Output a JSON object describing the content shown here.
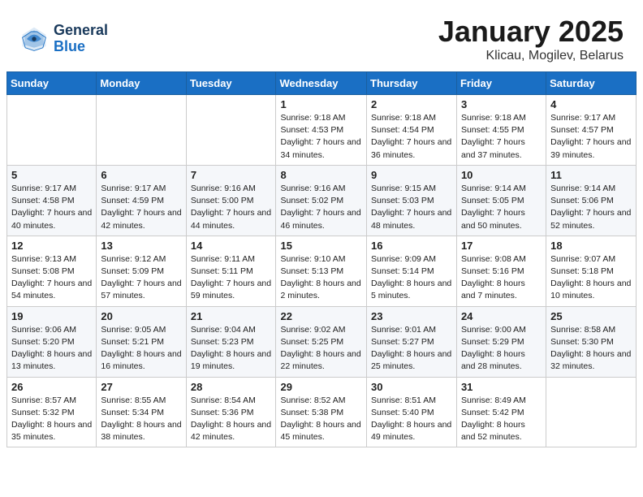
{
  "header": {
    "logo_line1": "General",
    "logo_line2": "Blue",
    "month_title": "January 2025",
    "location": "Klicau, Mogilev, Belarus"
  },
  "weekdays": [
    "Sunday",
    "Monday",
    "Tuesday",
    "Wednesday",
    "Thursday",
    "Friday",
    "Saturday"
  ],
  "weeks": [
    [
      {
        "day": "",
        "sunrise": "",
        "sunset": "",
        "daylight": ""
      },
      {
        "day": "",
        "sunrise": "",
        "sunset": "",
        "daylight": ""
      },
      {
        "day": "",
        "sunrise": "",
        "sunset": "",
        "daylight": ""
      },
      {
        "day": "1",
        "sunrise": "Sunrise: 9:18 AM",
        "sunset": "Sunset: 4:53 PM",
        "daylight": "Daylight: 7 hours and 34 minutes."
      },
      {
        "day": "2",
        "sunrise": "Sunrise: 9:18 AM",
        "sunset": "Sunset: 4:54 PM",
        "daylight": "Daylight: 7 hours and 36 minutes."
      },
      {
        "day": "3",
        "sunrise": "Sunrise: 9:18 AM",
        "sunset": "Sunset: 4:55 PM",
        "daylight": "Daylight: 7 hours and 37 minutes."
      },
      {
        "day": "4",
        "sunrise": "Sunrise: 9:17 AM",
        "sunset": "Sunset: 4:57 PM",
        "daylight": "Daylight: 7 hours and 39 minutes."
      }
    ],
    [
      {
        "day": "5",
        "sunrise": "Sunrise: 9:17 AM",
        "sunset": "Sunset: 4:58 PM",
        "daylight": "Daylight: 7 hours and 40 minutes."
      },
      {
        "day": "6",
        "sunrise": "Sunrise: 9:17 AM",
        "sunset": "Sunset: 4:59 PM",
        "daylight": "Daylight: 7 hours and 42 minutes."
      },
      {
        "day": "7",
        "sunrise": "Sunrise: 9:16 AM",
        "sunset": "Sunset: 5:00 PM",
        "daylight": "Daylight: 7 hours and 44 minutes."
      },
      {
        "day": "8",
        "sunrise": "Sunrise: 9:16 AM",
        "sunset": "Sunset: 5:02 PM",
        "daylight": "Daylight: 7 hours and 46 minutes."
      },
      {
        "day": "9",
        "sunrise": "Sunrise: 9:15 AM",
        "sunset": "Sunset: 5:03 PM",
        "daylight": "Daylight: 7 hours and 48 minutes."
      },
      {
        "day": "10",
        "sunrise": "Sunrise: 9:14 AM",
        "sunset": "Sunset: 5:05 PM",
        "daylight": "Daylight: 7 hours and 50 minutes."
      },
      {
        "day": "11",
        "sunrise": "Sunrise: 9:14 AM",
        "sunset": "Sunset: 5:06 PM",
        "daylight": "Daylight: 7 hours and 52 minutes."
      }
    ],
    [
      {
        "day": "12",
        "sunrise": "Sunrise: 9:13 AM",
        "sunset": "Sunset: 5:08 PM",
        "daylight": "Daylight: 7 hours and 54 minutes."
      },
      {
        "day": "13",
        "sunrise": "Sunrise: 9:12 AM",
        "sunset": "Sunset: 5:09 PM",
        "daylight": "Daylight: 7 hours and 57 minutes."
      },
      {
        "day": "14",
        "sunrise": "Sunrise: 9:11 AM",
        "sunset": "Sunset: 5:11 PM",
        "daylight": "Daylight: 7 hours and 59 minutes."
      },
      {
        "day": "15",
        "sunrise": "Sunrise: 9:10 AM",
        "sunset": "Sunset: 5:13 PM",
        "daylight": "Daylight: 8 hours and 2 minutes."
      },
      {
        "day": "16",
        "sunrise": "Sunrise: 9:09 AM",
        "sunset": "Sunset: 5:14 PM",
        "daylight": "Daylight: 8 hours and 5 minutes."
      },
      {
        "day": "17",
        "sunrise": "Sunrise: 9:08 AM",
        "sunset": "Sunset: 5:16 PM",
        "daylight": "Daylight: 8 hours and 7 minutes."
      },
      {
        "day": "18",
        "sunrise": "Sunrise: 9:07 AM",
        "sunset": "Sunset: 5:18 PM",
        "daylight": "Daylight: 8 hours and 10 minutes."
      }
    ],
    [
      {
        "day": "19",
        "sunrise": "Sunrise: 9:06 AM",
        "sunset": "Sunset: 5:20 PM",
        "daylight": "Daylight: 8 hours and 13 minutes."
      },
      {
        "day": "20",
        "sunrise": "Sunrise: 9:05 AM",
        "sunset": "Sunset: 5:21 PM",
        "daylight": "Daylight: 8 hours and 16 minutes."
      },
      {
        "day": "21",
        "sunrise": "Sunrise: 9:04 AM",
        "sunset": "Sunset: 5:23 PM",
        "daylight": "Daylight: 8 hours and 19 minutes."
      },
      {
        "day": "22",
        "sunrise": "Sunrise: 9:02 AM",
        "sunset": "Sunset: 5:25 PM",
        "daylight": "Daylight: 8 hours and 22 minutes."
      },
      {
        "day": "23",
        "sunrise": "Sunrise: 9:01 AM",
        "sunset": "Sunset: 5:27 PM",
        "daylight": "Daylight: 8 hours and 25 minutes."
      },
      {
        "day": "24",
        "sunrise": "Sunrise: 9:00 AM",
        "sunset": "Sunset: 5:29 PM",
        "daylight": "Daylight: 8 hours and 28 minutes."
      },
      {
        "day": "25",
        "sunrise": "Sunrise: 8:58 AM",
        "sunset": "Sunset: 5:30 PM",
        "daylight": "Daylight: 8 hours and 32 minutes."
      }
    ],
    [
      {
        "day": "26",
        "sunrise": "Sunrise: 8:57 AM",
        "sunset": "Sunset: 5:32 PM",
        "daylight": "Daylight: 8 hours and 35 minutes."
      },
      {
        "day": "27",
        "sunrise": "Sunrise: 8:55 AM",
        "sunset": "Sunset: 5:34 PM",
        "daylight": "Daylight: 8 hours and 38 minutes."
      },
      {
        "day": "28",
        "sunrise": "Sunrise: 8:54 AM",
        "sunset": "Sunset: 5:36 PM",
        "daylight": "Daylight: 8 hours and 42 minutes."
      },
      {
        "day": "29",
        "sunrise": "Sunrise: 8:52 AM",
        "sunset": "Sunset: 5:38 PM",
        "daylight": "Daylight: 8 hours and 45 minutes."
      },
      {
        "day": "30",
        "sunrise": "Sunrise: 8:51 AM",
        "sunset": "Sunset: 5:40 PM",
        "daylight": "Daylight: 8 hours and 49 minutes."
      },
      {
        "day": "31",
        "sunrise": "Sunrise: 8:49 AM",
        "sunset": "Sunset: 5:42 PM",
        "daylight": "Daylight: 8 hours and 52 minutes."
      },
      {
        "day": "",
        "sunrise": "",
        "sunset": "",
        "daylight": ""
      }
    ]
  ]
}
